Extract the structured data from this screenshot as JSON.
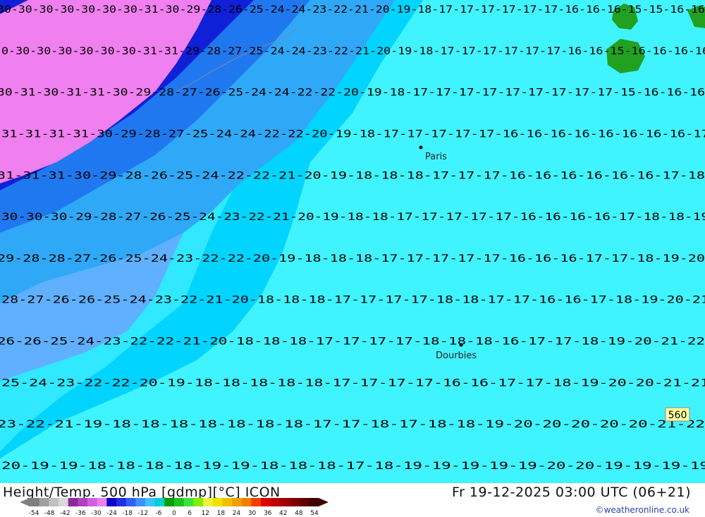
{
  "map": {
    "city_labels": [
      {
        "name": "Paris"
      },
      {
        "name": "Dourbies"
      }
    ],
    "badge": "560",
    "contour_rows": [
      "30-30-30-30-30-30-30-31-30-29-28-26-25-24-24-23-22-21-20-19-18-17-17-17-17-17-17-16-16-16-15-15-16-16",
      "0-30-30-30-30-30-30-31-31-29-28-27-25-24-24-23-22-21-20-19-18-17-17-17-17-17-17-16-16-15-16-16-16-16",
      "30-31-30-31-31-30-29-28-27-26-25-24-24-22-22-20-19-18-17-17-17-17-17-17-17-17-17-15-16-16-16",
      "31-31-31-31-30-29-28-27-25-24-24-22-22-20-19-18-17-17-17-17-17-16-16-16-16-16-16-16-16-17",
      "31-31-31-30-29-28-26-25-24-22-22-21-20-19-18-18-18-17-17-17-16-16-16-16-16-16-17-18",
      "30-30-30-29-28-27-26-25-24-23-22-21-20-19-18-18-17-17-17-17-17-16-16-16-16-17-18-18-19",
      "29-28-28-27-26-25-24-23-22-22-20-19-18-18-18-17-17-17-17-17-16-16-16-17-17-18-19-20",
      "28-27-26-26-25-24-23-22-21-20-18-18-18-17-17-17-17-18-18-17-17-16-16-17-18-19-20-21",
      "26-26-25-24-23-22-22-21-20-18-18-18-17-17-17-17-18-18-18-16-17-17-18-19-20-21-22",
      "25-24-23-22-22-20-19-18-18-18-18-18-17-17-17-17-16-16-17-17-18-19-20-20-21-21",
      "23-22-21-19-18-18-18-18-18-18-18-17-17-18-17-18-18-19-20-20-20-20-20-21-22",
      "20-19-19-18-18-18-18-19-19-18-18-18-17-18-19-19-19-19-19-20-20-19-19-19-19"
    ]
  },
  "footer": {
    "title": "Height/Temp. 500 hPa [gdmp][°C] ICON",
    "datetime": "Fr 19-12-2025 03:00 UTC (06+21)",
    "credit": "©weatheronline.co.uk",
    "legend_ticks": [
      "-54",
      "-48",
      "-42",
      "-36",
      "-30",
      "-24",
      "-18",
      "-12",
      "-6",
      "0",
      "6",
      "12",
      "18",
      "24",
      "30",
      "36",
      "42",
      "48",
      "54"
    ],
    "legend_colors": [
      "#808080",
      "#a0a0a0",
      "#c0c0c0",
      "#d8d8d8",
      "#8c2a9c",
      "#b040c0",
      "#d060e0",
      "#f080f0",
      "#1000c8",
      "#2030e0",
      "#3060f0",
      "#4090ff",
      "#40c0ff",
      "#00d0d0",
      "#00a000",
      "#20c020",
      "#40e040",
      "#80f000",
      "#f0f040",
      "#f0e000",
      "#f0c000",
      "#f0a000",
      "#f08000",
      "#f04000",
      "#e00000",
      "#c00000",
      "#a00000",
      "#800000",
      "#600000",
      "#400000"
    ]
  }
}
